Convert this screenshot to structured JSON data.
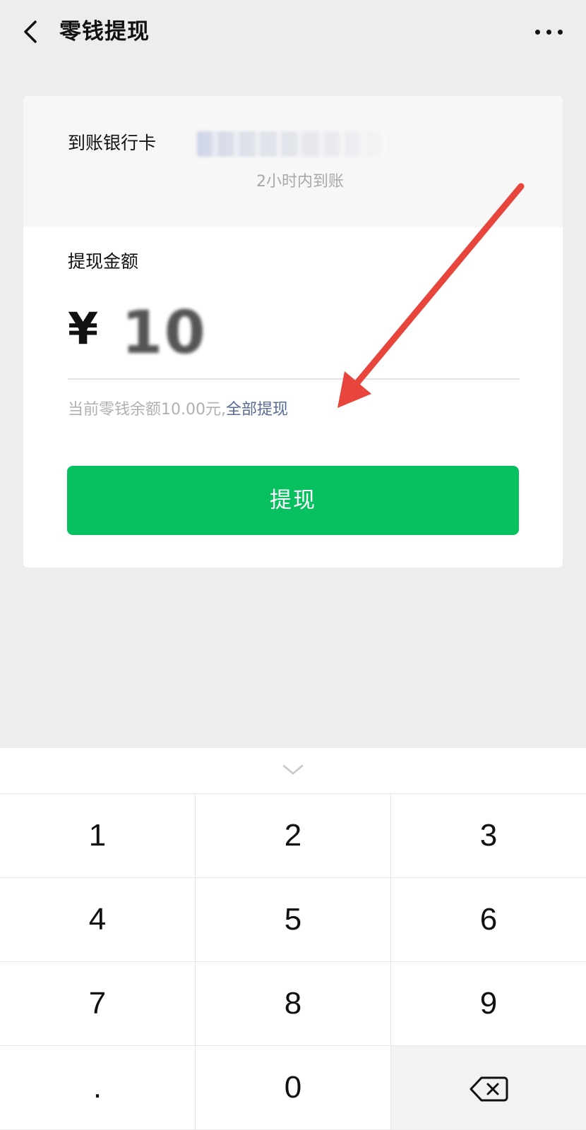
{
  "navbar": {
    "title": "零钱提现",
    "back_icon": "chevron-left-icon",
    "more_icon": "more-dots-icon"
  },
  "bank": {
    "label": "到账银行卡",
    "arrival_time": "2小时内到账"
  },
  "amount": {
    "label": "提现金额",
    "currency_symbol": "¥",
    "value": "10"
  },
  "balance": {
    "text": "当前零钱余额10.00元,",
    "withdraw_all": "全部提现"
  },
  "withdraw_button": {
    "label": "提现",
    "color": "#07c160"
  },
  "keypad": {
    "keys": [
      "1",
      "2",
      "3",
      "4",
      "5",
      "6",
      "7",
      "8",
      "9",
      ".",
      "0"
    ],
    "collapse_icon": "chevron-down-icon",
    "delete_icon": "backspace-icon"
  },
  "colors": {
    "link": "#576b95",
    "annotation_arrow": "#e8453c"
  }
}
